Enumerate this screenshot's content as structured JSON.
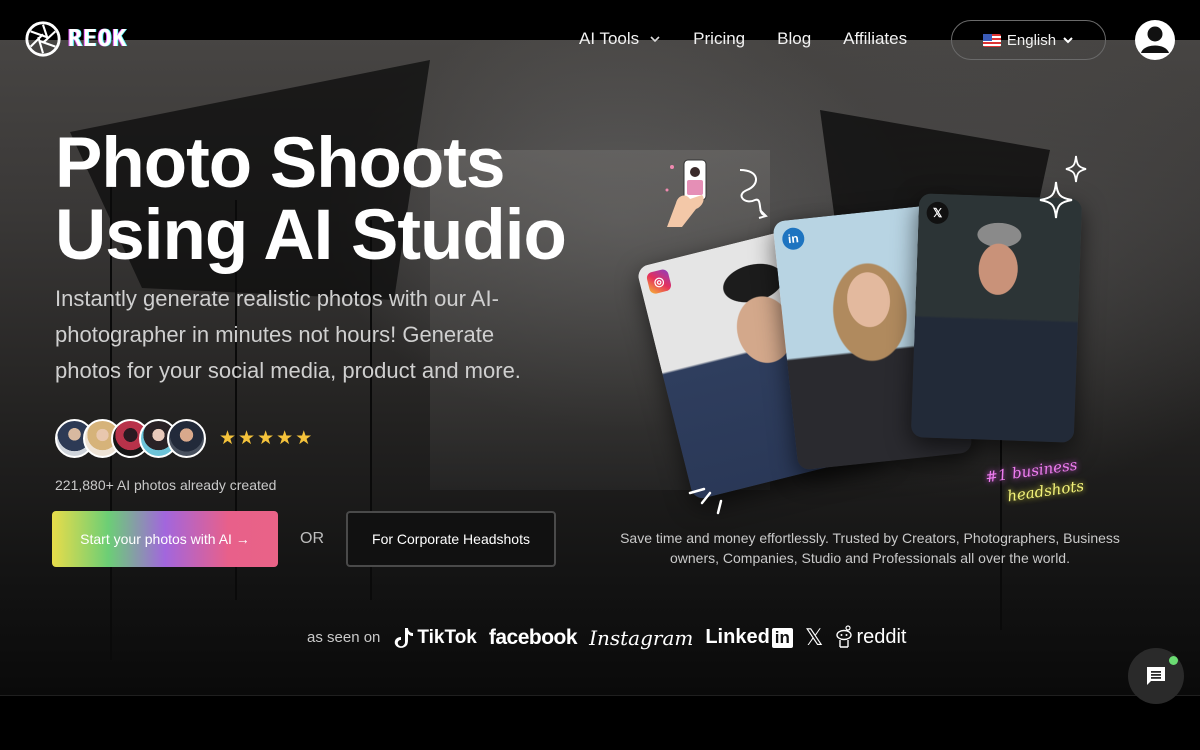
{
  "brand": {
    "name": "REOK"
  },
  "nav": {
    "items": [
      {
        "label": "AI Tools",
        "has_dropdown": true
      },
      {
        "label": "Pricing"
      },
      {
        "label": "Blog"
      },
      {
        "label": "Affiliates"
      }
    ],
    "language": {
      "label": "English",
      "flag": "us-flag-icon"
    },
    "account_icon": "user-avatar-icon"
  },
  "hero": {
    "headline_line1": "Photo Shoots",
    "headline_line2": "Using AI Studio",
    "subheadline": "Instantly generate realistic photos with our AI-photographer in minutes not hours! Generate photos for your social media, product and more.",
    "rating_stars": 5,
    "stars_glyph": "★",
    "photos_count": "221,880+ AI photos already created",
    "cta_primary": "Start your photos with AI →",
    "or_label": "OR",
    "cta_secondary": "For Corporate Headshots"
  },
  "showcase": {
    "cards": [
      {
        "platform": "instagram",
        "badge": "◎"
      },
      {
        "platform": "linkedin",
        "badge": "in"
      },
      {
        "platform": "x",
        "badge": "𝕏"
      }
    ],
    "neon_line1": "#1 business",
    "neon_line2": "headshots",
    "trust_text": "Save time and money effortlessly. Trusted by Creators, Photographers, Business owners, Companies, Studio and Professionals all over the world."
  },
  "as_seen_on": {
    "label": "as seen on",
    "brands": [
      "TikTok",
      "facebook",
      "Instagram",
      "Linked",
      "in",
      "𝕏",
      "reddit"
    ]
  },
  "chat": {
    "icon": "chat-bubble-icon",
    "status_color": "#6bdc73"
  }
}
